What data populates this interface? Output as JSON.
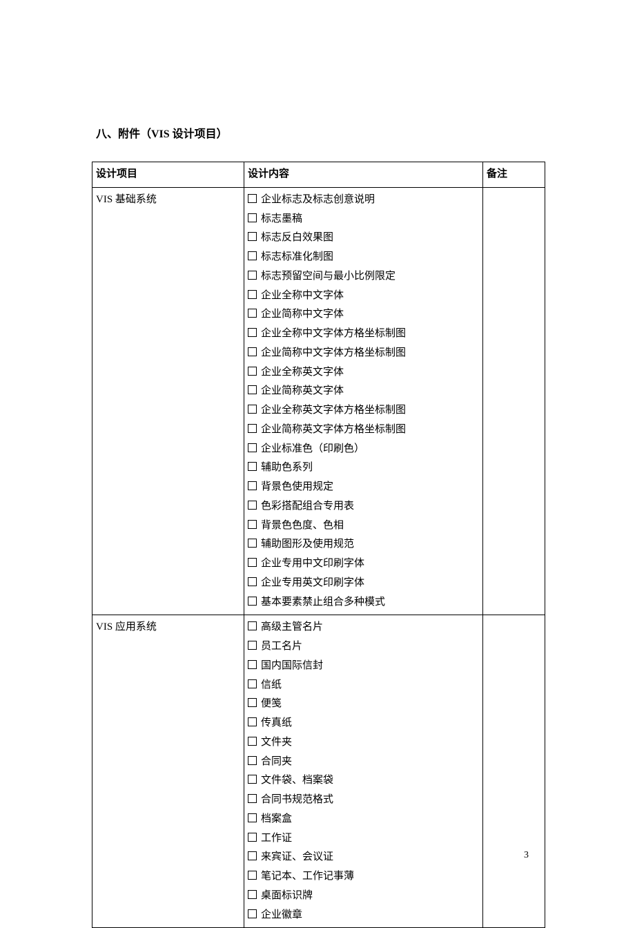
{
  "heading": "八、附件（VIS 设计项目）",
  "table": {
    "headers": {
      "project": "设计项目",
      "content": "设计内容",
      "remark": "备注"
    },
    "rows": [
      {
        "project": "VIS 基础系统",
        "items": [
          "企业标志及标志创意说明",
          "标志墨稿",
          "标志反白效果图",
          "标志标准化制图",
          "标志预留空间与最小比例限定",
          "企业全称中文字体",
          "企业简称中文字体",
          "企业全称中文字体方格坐标制图",
          "企业简称中文字体方格坐标制图",
          "企业全称英文字体",
          "企业简称英文字体",
          "企业全称英文字体方格坐标制图",
          "企业简称英文字体方格坐标制图",
          "企业标准色（印刷色）",
          "辅助色系列",
          "背景色使用规定",
          "色彩搭配组合专用表",
          "背景色色度、色相",
          "辅助图形及使用规范",
          "企业专用中文印刷字体",
          "企业专用英文印刷字体",
          "基本要素禁止组合多种模式"
        ],
        "remark": ""
      },
      {
        "project": "VIS 应用系统",
        "items": [
          "高级主管名片",
          "员工名片",
          "国内国际信封",
          "信纸",
          "便笺",
          "传真纸",
          "文件夹",
          "合同夹",
          "文件袋、档案袋",
          "合同书规范格式",
          "档案盒",
          "工作证",
          "来宾证、会议证",
          "笔记本、工作记事薄",
          "桌面标识牌",
          "企业徽章"
        ],
        "remark": ""
      }
    ]
  },
  "page_number": "3"
}
